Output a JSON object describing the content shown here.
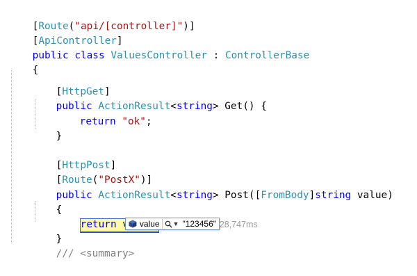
{
  "code": {
    "attr_route": {
      "open": "[",
      "type": "Route",
      "paren": "(",
      "string": "\"api/[controller]\"",
      "close": ")]"
    },
    "attr_apicontroller": {
      "open": "[",
      "type": "ApiController",
      "close": "]"
    },
    "class_decl": {
      "kw1": "public",
      "kw2": "class",
      "name": "ValuesController",
      "colon": " : ",
      "base": "ControllerBase"
    },
    "brace_open": "{",
    "httpget": {
      "open": "[",
      "type": "HttpGet",
      "close": "]"
    },
    "get_method": {
      "kw": "public",
      "type1": "ActionResult",
      "lt": "<",
      "kw2": "string",
      "gt": ">",
      "rest": " Get() {"
    },
    "return_ok": {
      "kw": "return",
      "string": "\"ok\"",
      "semi": ";"
    },
    "brace_close_get": "}",
    "httppost": {
      "open": "[",
      "type": "HttpPost",
      "close": "]"
    },
    "route_postx": {
      "open": "[",
      "type": "Route",
      "paren": "(",
      "string": "\"PostX\"",
      "close": ")]"
    },
    "post_method": {
      "kw": "public",
      "type1": "ActionResult",
      "lt": "<",
      "kw2": "string",
      "gt": "> Post([",
      "attr": "FromBody",
      "mid": "]",
      "kw3": "string",
      "rest": " value)"
    },
    "brace_open_post": "{",
    "return_value": {
      "kw": "return",
      "rest": " value;"
    },
    "elapsed_hint": "已用时间 <= 628,747ms",
    "brace_close_post": "}",
    "summary_comment": "/// <summary>"
  },
  "tooltip": {
    "name": "value",
    "value": "\"123456\"",
    "icons": [
      "cube-icon",
      "magnifier-icon",
      "dropdown-caret-icon"
    ]
  }
}
